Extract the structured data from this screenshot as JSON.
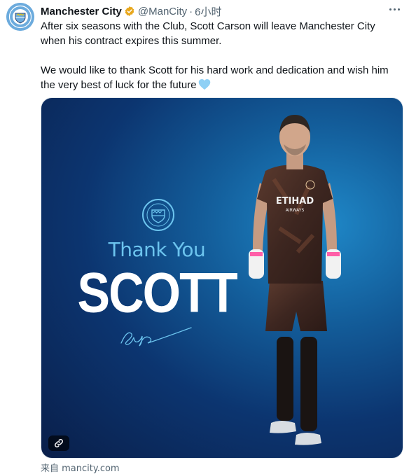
{
  "account": {
    "name": "Manchester City",
    "handle": "@ManCity",
    "separator": "·",
    "time": "6小时",
    "avatar_icon": "man-city-crest-icon",
    "verified_color": "#f4b400"
  },
  "tweet": {
    "paragraph1": "After six seasons with the Club, Scott Carson will leave Manchester City when his contract expires this summer.",
    "paragraph2": "We would like to thank Scott for his hard work and dedication and wish him the very best of luck for the future",
    "emoji": "light-blue-heart-icon"
  },
  "media": {
    "headline": "Thank You",
    "name": "SCOTT",
    "sponsor": "ETIHAD",
    "sponsor_sub": "AIRWAYS",
    "link_icon": "link-icon"
  },
  "footer": {
    "source": "来自 mancity.com"
  },
  "colors": {
    "accent": "#6cabdd",
    "text": "#0f1419",
    "muted": "#536471"
  }
}
